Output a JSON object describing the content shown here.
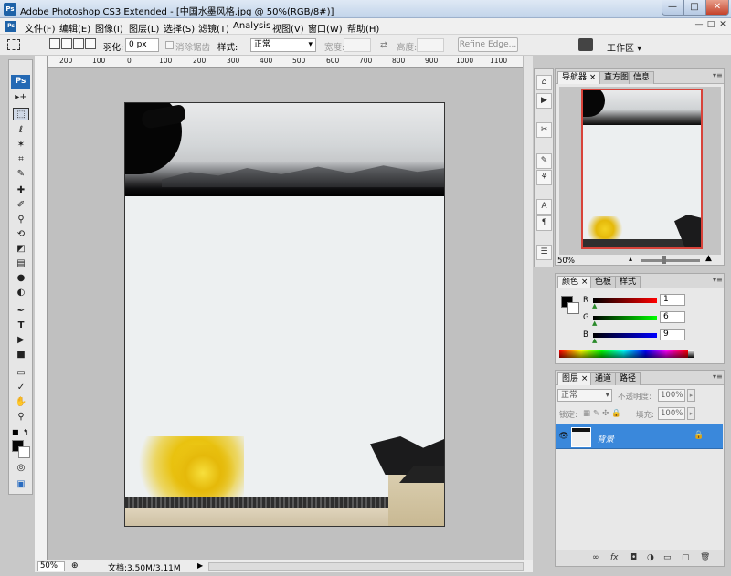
{
  "window": {
    "title": "Adobe Photoshop CS3 Extended - [中国水墨风格.jpg @ 50%(RGB/8#)]",
    "app_icon_text": "Ps",
    "min_glyph": "—",
    "max_glyph": "□",
    "close_glyph": "✕"
  },
  "menu": {
    "items": [
      "文件(F)",
      "编辑(E)",
      "图像(I)",
      "图层(L)",
      "选择(S)",
      "滤镜(T)",
      "Analysis",
      "视图(V)",
      "窗口(W)",
      "帮助(H)"
    ]
  },
  "options": {
    "feather_label": "羽化:",
    "feather_value": "0 px",
    "antialias_label": "消除锯齿",
    "style_label": "样式:",
    "style_value": "正常",
    "width_label": "宽度:",
    "height_label": "高度:",
    "refine_edge": "Refine Edge...",
    "workspace": "工作区 ▾"
  },
  "toolbox": {
    "logo": "Ps",
    "tools": [
      {
        "name": "move-tool",
        "glyph": "▸+"
      },
      {
        "name": "marquee-tool",
        "glyph": "⬚"
      },
      {
        "name": "lasso-tool",
        "glyph": "ℓ"
      },
      {
        "name": "magic-wand-tool",
        "glyph": "✶"
      },
      {
        "name": "crop-tool",
        "glyph": "⌗"
      },
      {
        "name": "slice-tool",
        "glyph": "✎"
      },
      {
        "name": "healing-brush-tool",
        "glyph": "✚"
      },
      {
        "name": "brush-tool",
        "glyph": "✐"
      },
      {
        "name": "clone-stamp-tool",
        "glyph": "⚲"
      },
      {
        "name": "history-brush-tool",
        "glyph": "⟲"
      },
      {
        "name": "eraser-tool",
        "glyph": "◩"
      },
      {
        "name": "gradient-tool",
        "glyph": "▤"
      },
      {
        "name": "blur-tool",
        "glyph": "●"
      },
      {
        "name": "dodge-tool",
        "glyph": "◐"
      },
      {
        "name": "pen-tool",
        "glyph": "✒"
      },
      {
        "name": "type-tool",
        "glyph": "T"
      },
      {
        "name": "path-selection-tool",
        "glyph": "▶"
      },
      {
        "name": "shape-tool",
        "glyph": "■"
      },
      {
        "name": "notes-tool",
        "glyph": "▭"
      },
      {
        "name": "eyedropper-tool",
        "glyph": "✓"
      },
      {
        "name": "hand-tool",
        "glyph": "✋"
      },
      {
        "name": "zoom-tool",
        "glyph": "⚲"
      }
    ],
    "quickmask_glyph": "◎",
    "screenmode_glyph": "▣"
  },
  "ruler": {
    "marks": [
      "200",
      "100",
      "0",
      "100",
      "200",
      "300",
      "400",
      "500",
      "600",
      "700",
      "800",
      "900",
      "1000",
      "1100"
    ]
  },
  "status": {
    "zoom": "50%",
    "doc_info": "文档:3.50M/3.11M"
  },
  "navigator": {
    "tabs": [
      "导航器",
      "直方图",
      "信息"
    ],
    "zoom": "50%"
  },
  "color": {
    "tabs": [
      "颜色",
      "色板",
      "样式"
    ],
    "r_label": "R",
    "g_label": "G",
    "b_label": "B",
    "r_value": "1",
    "g_value": "6",
    "b_value": "9"
  },
  "layers": {
    "tabs": [
      "图层",
      "通道",
      "路径"
    ],
    "blend_mode": "正常",
    "opacity_label": "不透明度:",
    "opacity_value": "100%",
    "lock_label": "锁定:",
    "fill_label": "填充:",
    "fill_value": "100%",
    "layer_name": "背景",
    "footer_icons": [
      "∞",
      "fx",
      "◘",
      "◑",
      "▭",
      "▢",
      "🗑"
    ]
  },
  "colors": {
    "accent_selection": "#3a88db",
    "navigator_frame": "#d8433a"
  }
}
